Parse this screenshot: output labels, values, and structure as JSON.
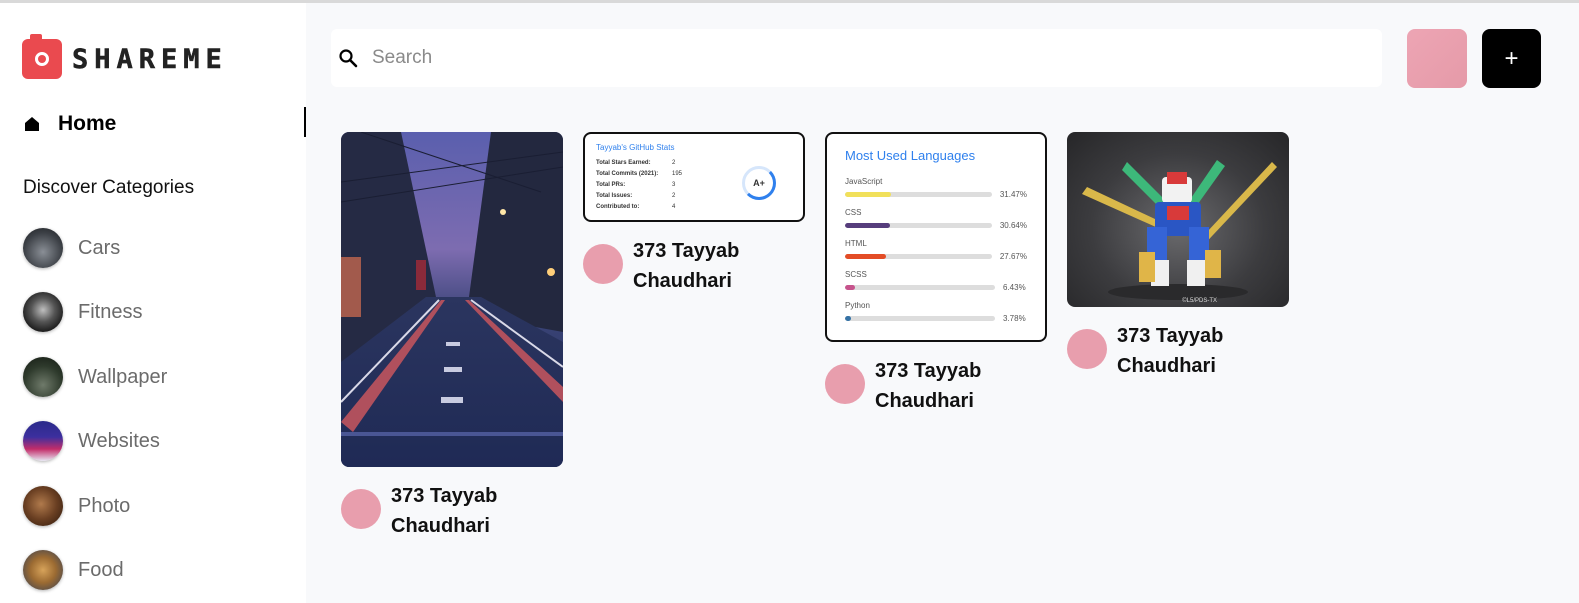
{
  "brand": {
    "name": "SHAREME"
  },
  "sidebar": {
    "home_label": "Home",
    "discover_label": "Discover Categories",
    "categories": [
      {
        "label": "Cars"
      },
      {
        "label": "Fitness"
      },
      {
        "label": "Wallpaper"
      },
      {
        "label": "Websites"
      },
      {
        "label": "Photo"
      },
      {
        "label": "Food"
      }
    ]
  },
  "header": {
    "search_placeholder": "Search",
    "add_label": "+"
  },
  "pins": [
    {
      "user": "373 Tayyab Chaudhari"
    },
    {
      "user": "373 Tayyab Chaudhari",
      "card": {
        "title": "Tayyab's GitHub Stats",
        "rows": [
          {
            "key": "Total Stars Earned:",
            "value": "2"
          },
          {
            "key": "Total Commits (2021):",
            "value": "195"
          },
          {
            "key": "Total PRs:",
            "value": "3"
          },
          {
            "key": "Total Issues:",
            "value": "2"
          },
          {
            "key": "Contributed to:",
            "value": "4"
          }
        ],
        "grade": "A+"
      }
    },
    {
      "user": "373 Tayyab Chaudhari",
      "card": {
        "title": "Most Used Languages",
        "languages": [
          {
            "name": "JavaScript",
            "percent": "31.47%",
            "value": 31.47,
            "color": "#f1e05a"
          },
          {
            "name": "CSS",
            "percent": "30.64%",
            "value": 30.64,
            "color": "#563d7c"
          },
          {
            "name": "HTML",
            "percent": "27.67%",
            "value": 27.67,
            "color": "#e34c26"
          },
          {
            "name": "SCSS",
            "percent": "6.43%",
            "value": 6.43,
            "color": "#c6538c"
          },
          {
            "name": "Python",
            "percent": "3.78%",
            "value": 3.78,
            "color": "#3572a5"
          }
        ]
      }
    },
    {
      "user": "373 Tayyab Chaudhari",
      "caption": "©L5/PDS-TX"
    }
  ],
  "colors": {
    "accent": "#ea4a4f",
    "avatar": "#e89ead"
  }
}
